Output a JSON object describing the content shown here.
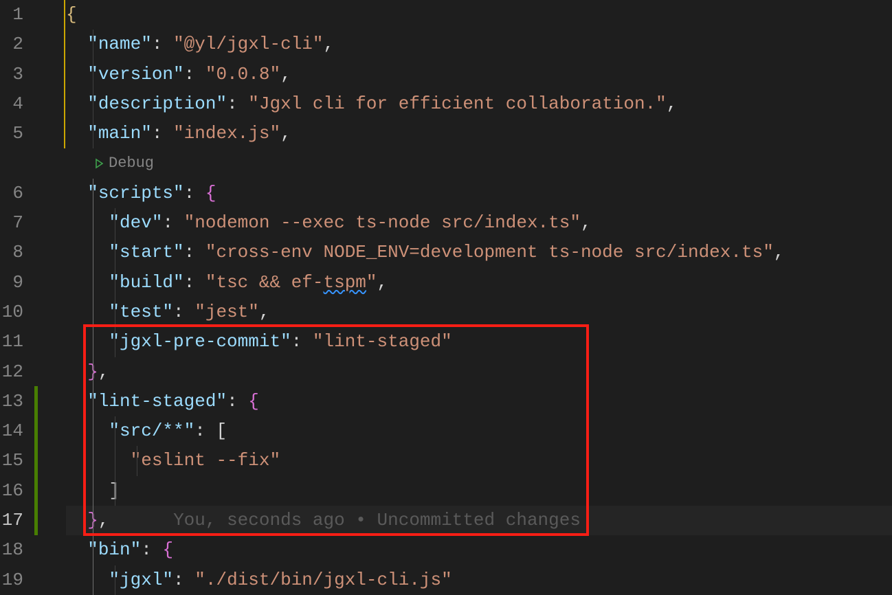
{
  "debug_label": "Debug",
  "blame_text": "You, seconds ago • Uncommitted changes",
  "line_numbers": [
    "1",
    "2",
    "3",
    "4",
    "5",
    "6",
    "7",
    "8",
    "9",
    "10",
    "11",
    "12",
    "13",
    "14",
    "15",
    "16",
    "17",
    "18",
    "19"
  ],
  "current_line": "17",
  "json": {
    "l1_brace": "{",
    "l2_key": "\"name\"",
    "l2_val": "\"@yl/jgxl-cli\"",
    "l3_key": "\"version\"",
    "l3_val": "\"0.0.8\"",
    "l4_key": "\"description\"",
    "l4_val": "\"Jgxl cli for efficient collaboration.\"",
    "l5_key": "\"main\"",
    "l5_val": "\"index.js\"",
    "l6_key": "\"scripts\"",
    "l7_key": "\"dev\"",
    "l7_val": "\"nodemon --exec ts-node src/index.ts\"",
    "l8_key": "\"start\"",
    "l8_val": "\"cross-env NODE_ENV=development ts-node src/index.ts\"",
    "l9_key": "\"build\"",
    "l9_val_a": "\"tsc && ef-",
    "l9_val_b": "tspm",
    "l9_val_c": "\"",
    "l10_key": "\"test\"",
    "l10_val": "\"jest\"",
    "l11_key": "\"jgxl-pre-commit\"",
    "l11_val": "\"lint-staged\"",
    "l13_key": "\"lint-staged\"",
    "l14_key": "\"src/**\"",
    "l15_val": "\"eslint --fix\"",
    "l18_key": "\"bin\"",
    "l19_key": "\"jgxl\"",
    "l19_val": "\"./dist/bin/jgxl-cli.js\""
  }
}
